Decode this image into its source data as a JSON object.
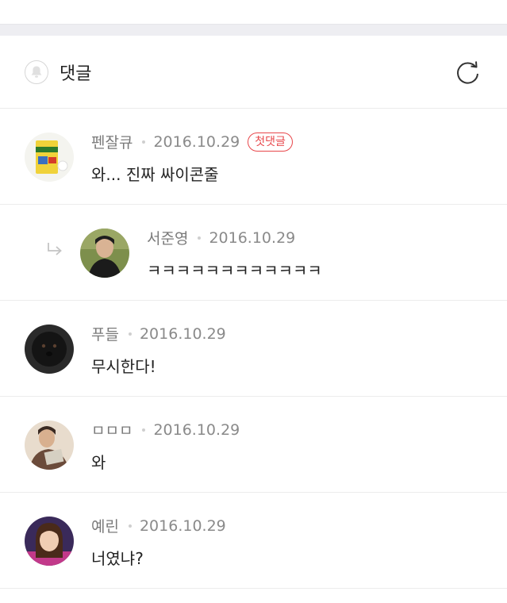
{
  "header": {
    "title": "댓글"
  },
  "comments": [
    {
      "author": "펜잘큐",
      "date": "2016.10.29",
      "badge": "첫댓글",
      "text": "와... 진짜 싸이콘줄",
      "reply": false
    },
    {
      "author": "서준영",
      "date": "2016.10.29",
      "text": "ㅋㅋㅋㅋㅋㅋㅋㅋㅋㅋㅋㅋ",
      "reply": true
    },
    {
      "author": "푸들",
      "date": "2016.10.29",
      "text": "무시한다!",
      "reply": false
    },
    {
      "author": "ㅁㅁㅁ",
      "date": "2016.10.29",
      "text": "와",
      "reply": false
    },
    {
      "author": "예린",
      "date": "2016.10.29",
      "text": "너였냐?",
      "reply": false
    }
  ],
  "colors": {
    "badge": "#e8474b",
    "separator": "#ececec",
    "band": "#eeeef2"
  },
  "icons": [
    "bell-icon",
    "refresh-icon",
    "reply-arrow-icon"
  ]
}
